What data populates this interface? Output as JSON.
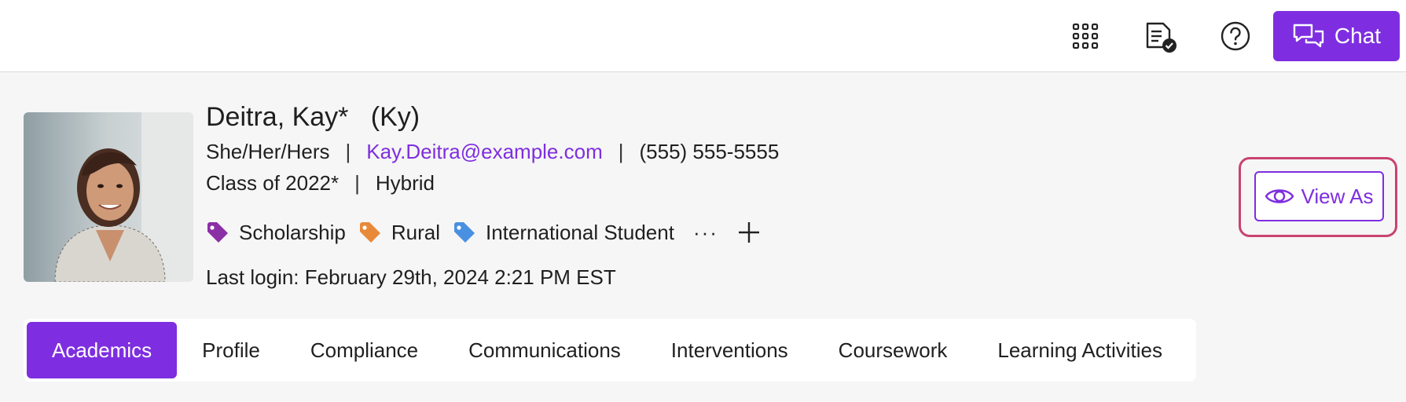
{
  "topbar": {
    "icons": [
      "apps-grid-icon",
      "document-check-icon",
      "help-icon"
    ],
    "chat_label": "Chat",
    "accent": "#7e2ee0"
  },
  "student": {
    "name": "Deitra, Kay*",
    "preferred_name": "(Ky)",
    "pronouns": "She/Her/Hers",
    "email": "Kay.Deitra@example.com",
    "phone": "(555) 555-5555",
    "class_year": "Class of 2022*",
    "modality": "Hybrid",
    "tags": [
      {
        "label": "Scholarship",
        "color": "#8b2fa6"
      },
      {
        "label": "Rural",
        "color": "#e8893a"
      },
      {
        "label": "International Student",
        "color": "#4a90e2"
      }
    ],
    "more_label": "···",
    "last_login": "Last login: February 29th, 2024 2:21 PM EST"
  },
  "view_as_label": "View As",
  "tabs": [
    {
      "label": "Academics",
      "active": true
    },
    {
      "label": "Profile"
    },
    {
      "label": "Compliance"
    },
    {
      "label": "Communications"
    },
    {
      "label": "Interventions"
    },
    {
      "label": "Coursework"
    },
    {
      "label": "Learning Activities"
    }
  ],
  "highlight_color": "#c9436f",
  "separator": "|"
}
